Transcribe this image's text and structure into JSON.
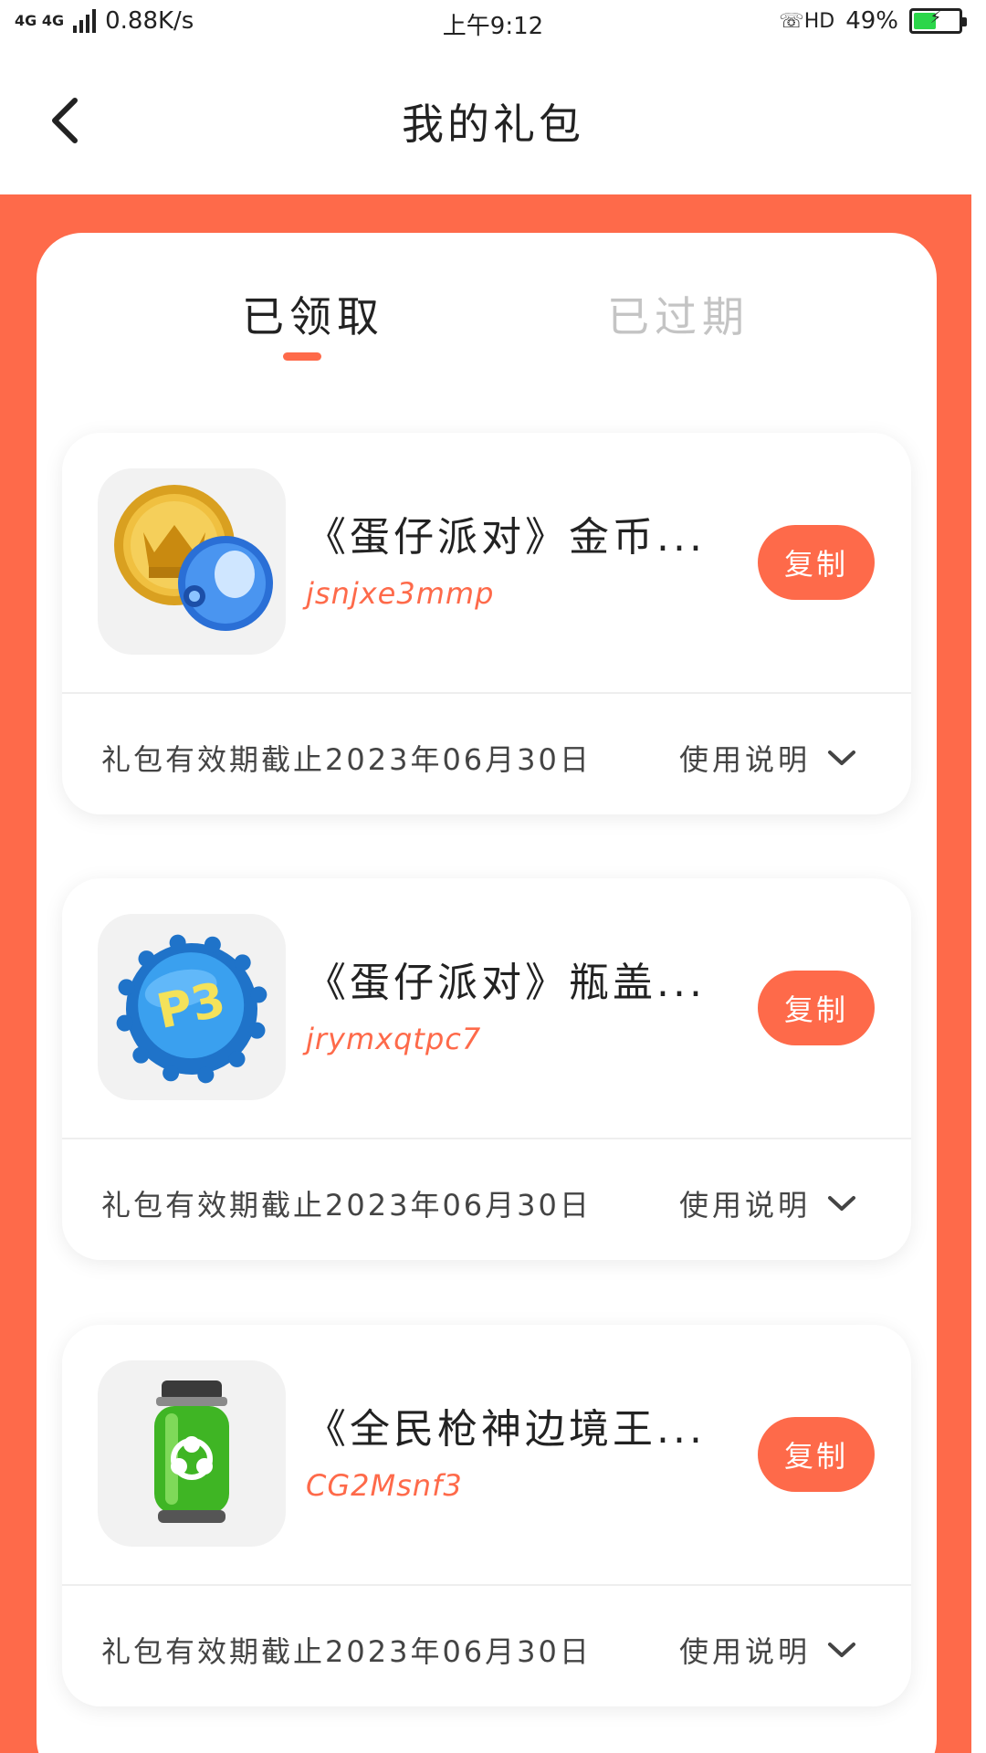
{
  "status_bar": {
    "network": "4G 4G",
    "speed": "0.88K/s",
    "time": "上午9:12",
    "hd": "HD",
    "battery": "49%",
    "battery_level": 0.49
  },
  "header": {
    "title": "我的礼包"
  },
  "tabs": [
    {
      "label": "已领取",
      "active": true
    },
    {
      "label": "已过期",
      "active": false
    }
  ],
  "gifts": [
    {
      "title": "《蛋仔派对》金币...",
      "code": "jsnjxe3mmp",
      "copy_label": "复制",
      "validity": "礼包有效期截止2023年06月30日",
      "usage_label": "使用说明",
      "icon": "coin-and-capsule-icon"
    },
    {
      "title": "《蛋仔派对》瓶盖...",
      "code": "jrymxqtpc7",
      "copy_label": "复制",
      "validity": "礼包有效期截止2023年06月30日",
      "usage_label": "使用说明",
      "icon": "bottle-cap-icon"
    },
    {
      "title": "《全民枪神边境王...",
      "code": "CG2Msnf3",
      "copy_label": "复制",
      "validity": "礼包有效期截止2023年06月30日",
      "usage_label": "使用说明",
      "icon": "biohazard-canister-icon"
    }
  ],
  "colors": {
    "accent": "#fe6a4a",
    "tab_inactive": "#c4c4c4",
    "battery": "#2bd64a"
  }
}
